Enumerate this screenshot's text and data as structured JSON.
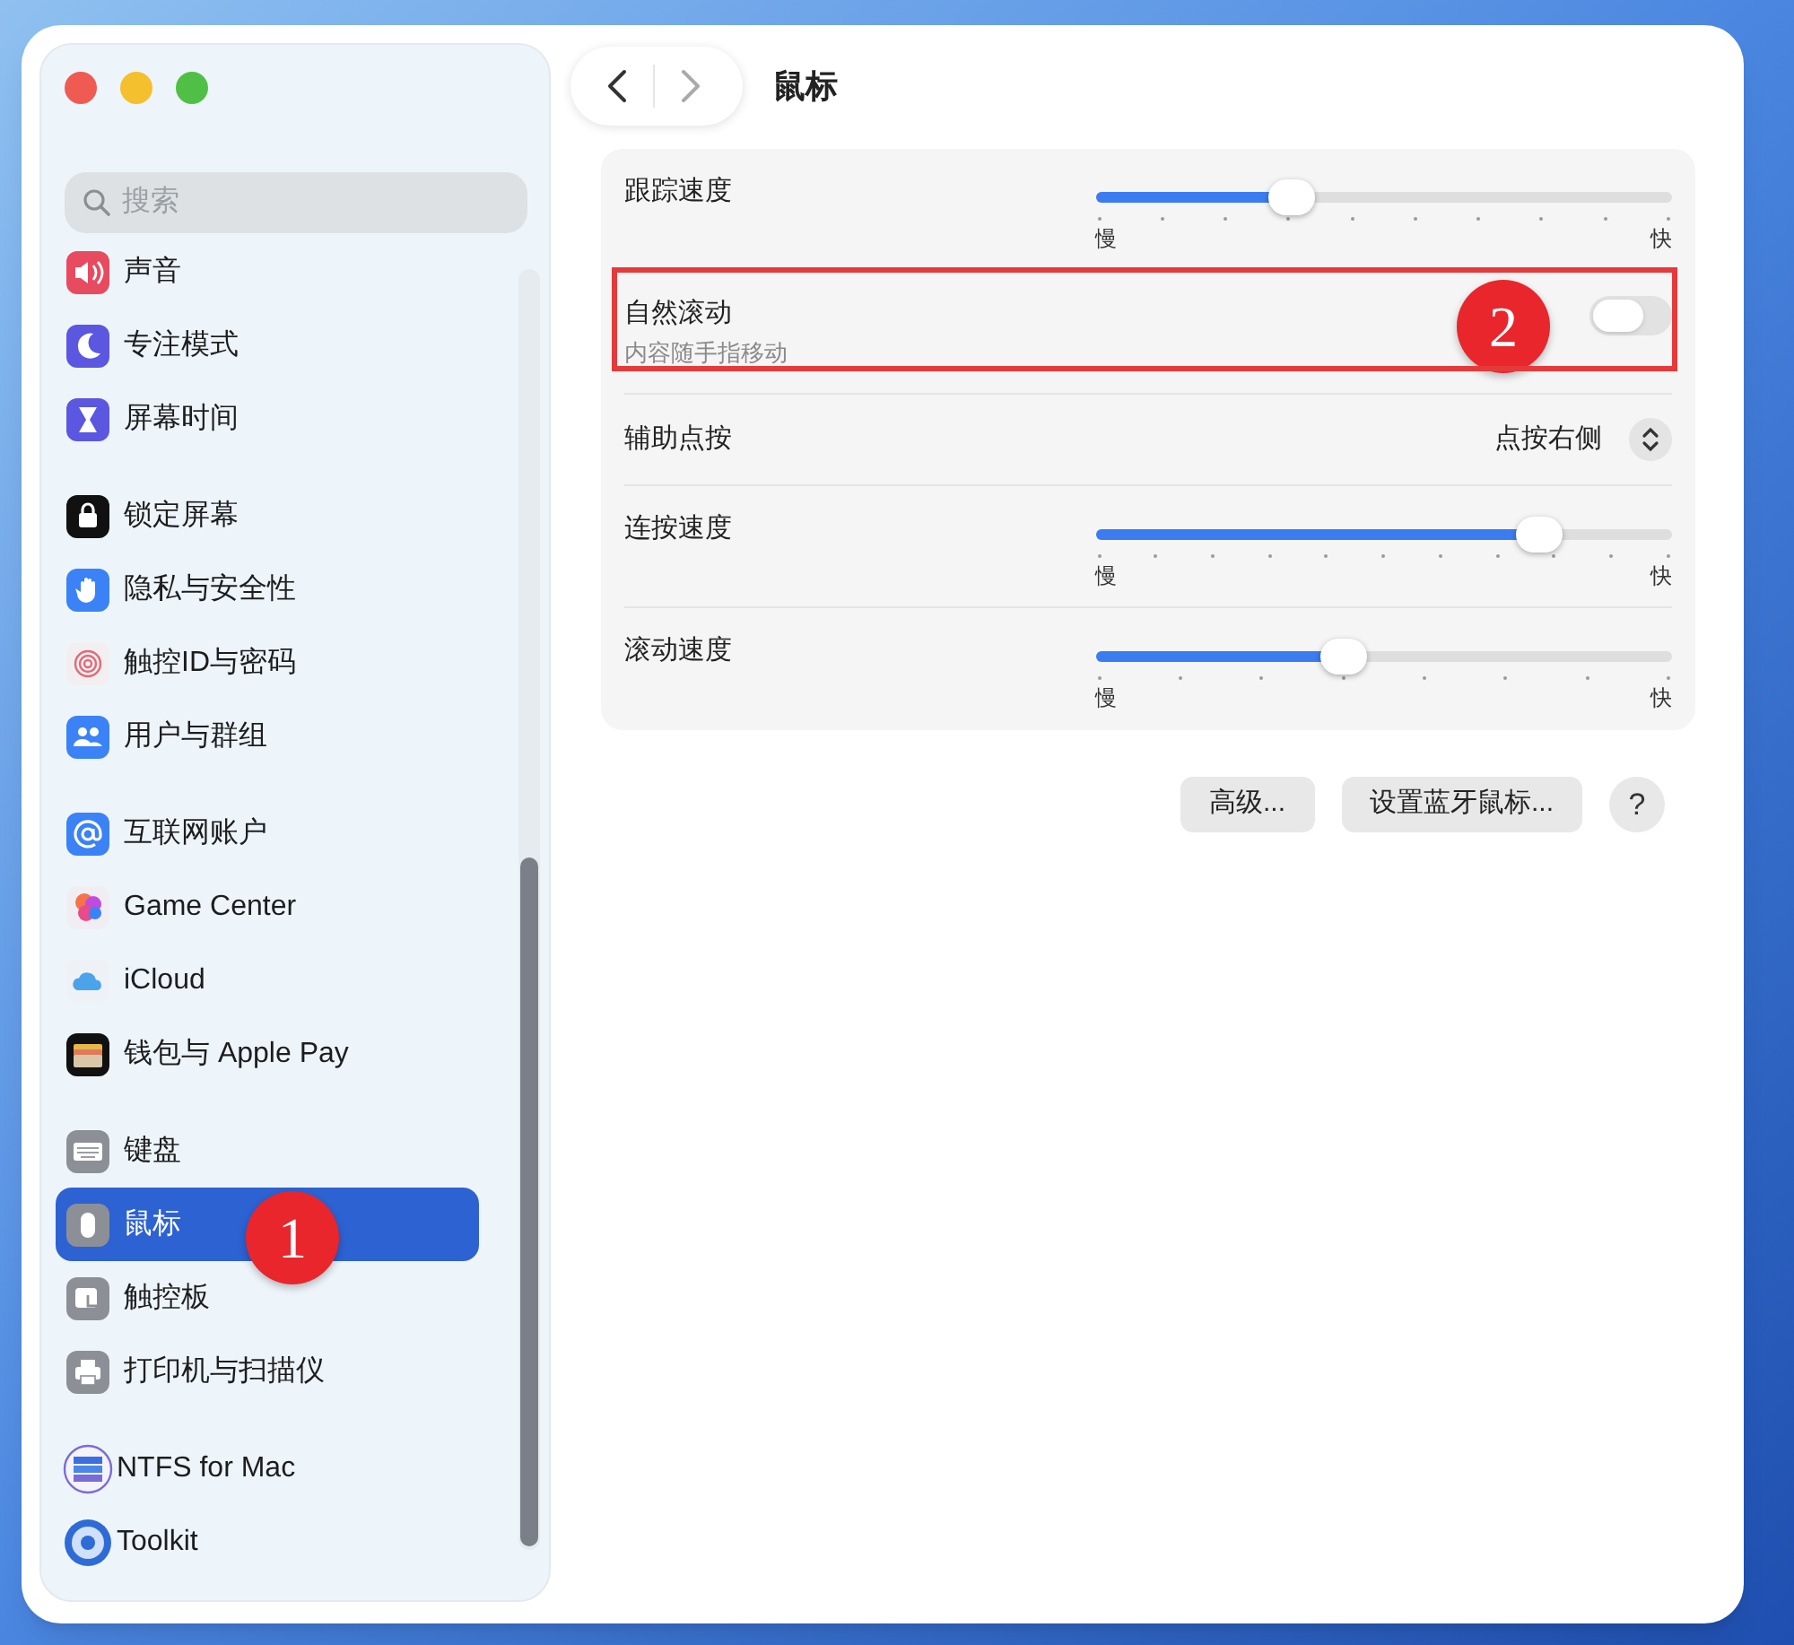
{
  "window": {
    "title": "鼠标"
  },
  "search": {
    "placeholder": "搜索"
  },
  "sidebar": {
    "groups": [
      {
        "items": [
          {
            "label": "声音",
            "kind": "sound",
            "selected": false
          },
          {
            "label": "专注模式",
            "kind": "focus",
            "selected": false
          },
          {
            "label": "屏幕时间",
            "kind": "screentime",
            "selected": false
          }
        ]
      },
      {
        "items": [
          {
            "label": "锁定屏幕",
            "kind": "lock",
            "selected": false
          },
          {
            "label": "隐私与安全性",
            "kind": "privacy",
            "selected": false
          },
          {
            "label": "触控ID与密码",
            "kind": "touchid",
            "selected": false
          },
          {
            "label": "用户与群组",
            "kind": "users",
            "selected": false
          }
        ]
      },
      {
        "items": [
          {
            "label": "互联网账户",
            "kind": "internet",
            "selected": false
          },
          {
            "label": "Game Center",
            "kind": "gamecenter",
            "selected": false
          },
          {
            "label": "iCloud",
            "kind": "icloud",
            "selected": false
          },
          {
            "label": "钱包与 Apple Pay",
            "kind": "wallet",
            "selected": false
          }
        ]
      },
      {
        "items": [
          {
            "label": "键盘",
            "kind": "keyboard",
            "selected": false
          },
          {
            "label": "鼠标",
            "kind": "mouse",
            "selected": true,
            "badge": "1"
          },
          {
            "label": "触控板",
            "kind": "trackpad",
            "selected": false
          },
          {
            "label": "打印机与扫描仪",
            "kind": "printer",
            "selected": false
          }
        ]
      },
      {
        "items": [
          {
            "label": "NTFS for Mac",
            "kind": "ntfs",
            "selected": false
          },
          {
            "label": "Toolkit",
            "kind": "toolkit",
            "selected": false
          }
        ]
      }
    ]
  },
  "settings": [
    {
      "kind": "slider",
      "label": "跟踪速度",
      "level": 0.34,
      "min_label": "慢",
      "max_label": "快"
    },
    {
      "kind": "toggle",
      "label": "自然滚动",
      "description": "内容随手指移动",
      "on": false,
      "highlighted": true,
      "badge": "2"
    },
    {
      "kind": "popup",
      "label": "辅助点按",
      "value": "点按右侧"
    },
    {
      "kind": "slider",
      "label": "连按速度",
      "level": 0.77,
      "min_label": "慢",
      "max_label": "快"
    },
    {
      "kind": "slider",
      "label": "滚动速度",
      "level": 0.43,
      "min_label": "慢",
      "max_label": "快"
    }
  ],
  "buttons": [
    {
      "label": "高级...",
      "kind": "text"
    },
    {
      "label": "设置蓝牙鼠标...",
      "kind": "text"
    },
    {
      "label": "?",
      "kind": "help"
    }
  ]
}
